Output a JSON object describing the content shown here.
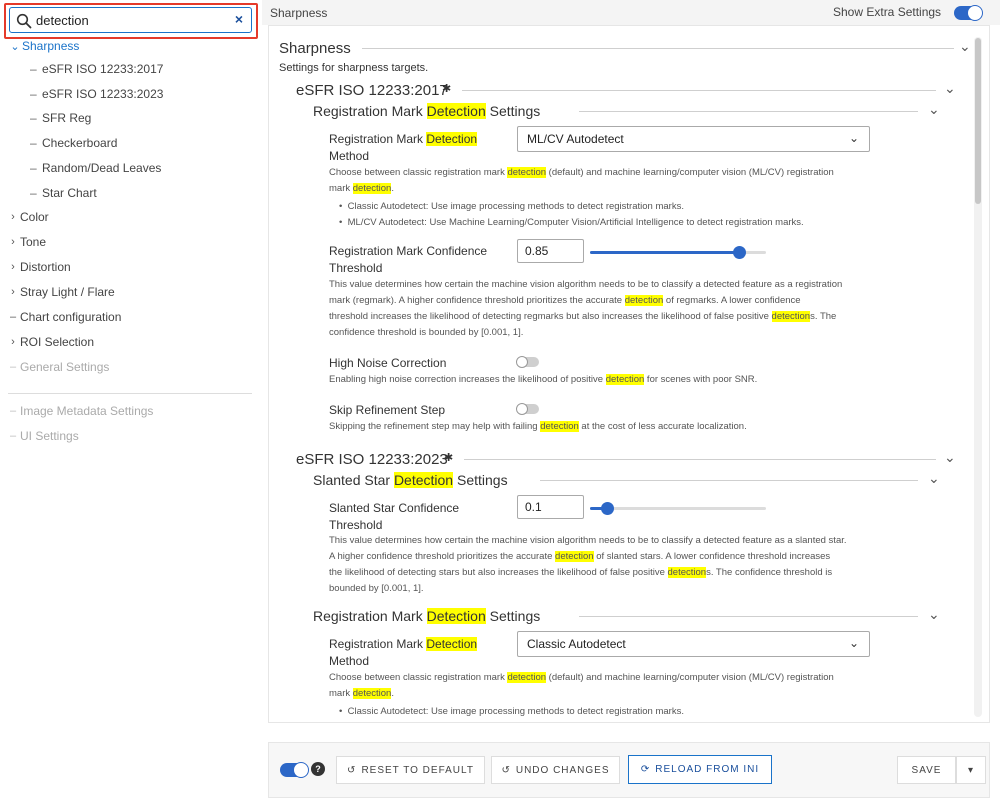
{
  "search": {
    "value": "detection",
    "placeholder": "Search"
  },
  "sidebar": {
    "items": [
      {
        "label": "Sharpness",
        "expanded": true,
        "active": true
      },
      {
        "label": "eSFR ISO 12233:2017"
      },
      {
        "label": "eSFR ISO 12233:2023"
      },
      {
        "label": "SFR Reg"
      },
      {
        "label": "Checkerboard"
      },
      {
        "label": "Random/Dead Leaves"
      },
      {
        "label": "Star Chart"
      },
      {
        "label": "Color"
      },
      {
        "label": "Tone"
      },
      {
        "label": "Distortion"
      },
      {
        "label": "Stray Light / Flare"
      },
      {
        "label": "Chart configuration"
      },
      {
        "label": "ROI Selection"
      },
      {
        "label": "General Settings"
      },
      {
        "label": "Image Metadata Settings"
      },
      {
        "label": "UI Settings"
      }
    ]
  },
  "header": {
    "title": "Sharpness",
    "extra_label": "Show Extra Settings",
    "extra_on": true
  },
  "main": {
    "section_title": "Sharpness",
    "section_desc": "Settings for sharpness targets.",
    "g1": {
      "title": "eSFR ISO 12233:2017",
      "sub_pre": "Registration Mark ",
      "hl": "Detection",
      "sub_post": " Settings",
      "method_label_pre": "Registration Mark ",
      "method_label_line2": "Method",
      "method_value": "ML/CV Autodetect",
      "method_desc_1a": "Choose between classic registration mark ",
      "hl_lower": "detection",
      "method_desc_1b": " (default) and machine learning/computer vision (ML/CV) registration",
      "method_desc_2a": "mark ",
      "method_desc_2b": ".",
      "bullet1": "Classic Autodetect: Use image processing methods to detect registration marks.",
      "bullet2": "ML/CV Autodetect: Use Machine Learning/Computer Vision/Artificial Intelligence to detect registration marks.",
      "conf_label_1": "Registration Mark Confidence",
      "conf_label_2": "Threshold",
      "conf_value": "0.85",
      "conf_desc_1": "This value determines how certain the machine vision algorithm needs to be to classify a detected feature as a registration",
      "conf_desc_2a": "mark (regmark). A higher confidence threshold prioritizes the accurate ",
      "conf_desc_2b": " of regmarks. A lower confidence",
      "conf_desc_3a": "threshold increases the likelihood of detecting regmarks but also increases the likelihood of false positive ",
      "hl_plural": "detection",
      "conf_desc_3b": "s. The",
      "conf_desc_4": "confidence threshold is bounded by [0.001, 1].",
      "noise_label": "High Noise Correction",
      "noise_desc_a": "Enabling high noise correction increases the likelihood of positive ",
      "noise_desc_b": " for scenes with poor SNR.",
      "skip_label": "Skip Refinement Step",
      "skip_desc_a": "Skipping the refinement step may help with failing ",
      "skip_desc_b": " at the cost of less accurate localization."
    },
    "g2": {
      "title": "eSFR ISO 12233:2023",
      "sub_pre": "Slanted Star ",
      "sub_post": " Settings",
      "star_label_1": "Slanted Star Confidence",
      "star_label_2": "Threshold",
      "star_value": "0.1",
      "star_desc_1": "This value determines how certain the machine vision algorithm needs to be to classify a detected feature as a slanted star.",
      "star_desc_2a": "A higher confidence threshold prioritizes the accurate ",
      "star_desc_2b": " of slanted stars. A lower confidence threshold increases",
      "star_desc_3a": "the likelihood of detecting stars but also increases the likelihood of false positive ",
      "star_desc_3b": "s. The confidence threshold is",
      "star_desc_4": "bounded by [0.001, 1].",
      "reg_sub_pre": "Registration Mark ",
      "reg_method_value": "Classic Autodetect"
    }
  },
  "sliders": {
    "conf_fraction": 0.85,
    "star_fraction": 0.1
  },
  "footer": {
    "reset": "RESET TO DEFAULT",
    "undo": "UNDO CHANGES",
    "reload": "RELOAD FROM INI",
    "save": "SAVE",
    "help": "?"
  },
  "colors": {
    "accent": "#2c67c7",
    "highlight": "#ffff00",
    "search_outline": "#e53a2a"
  }
}
